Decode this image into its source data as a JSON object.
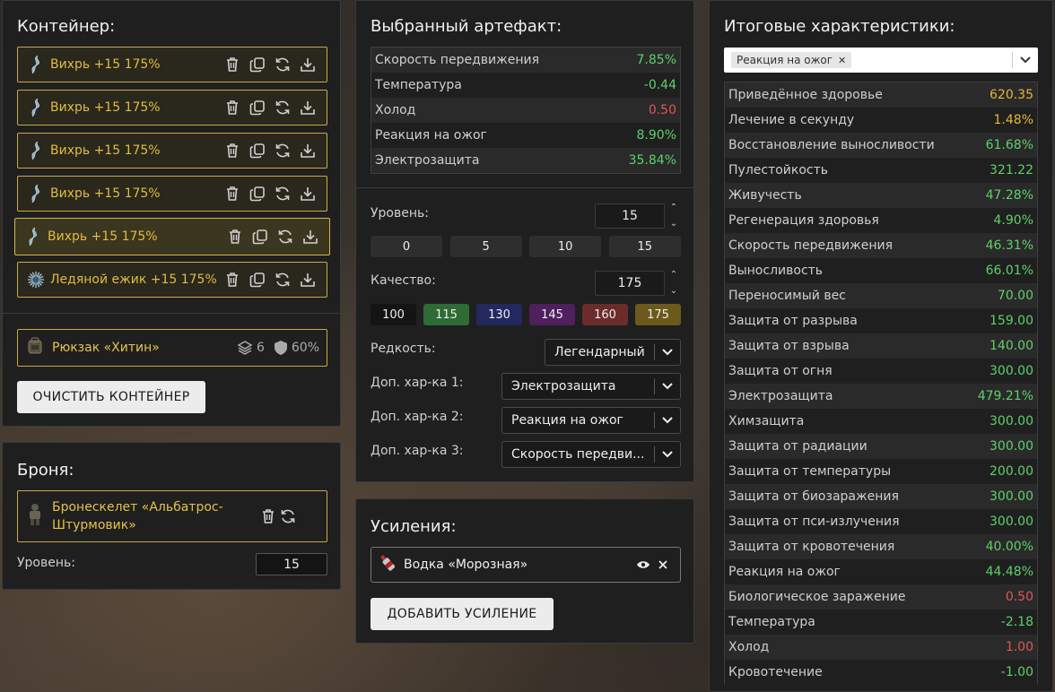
{
  "container": {
    "title": "Контейнер:",
    "artifacts": [
      {
        "label": "Вихрь +15 175%",
        "icon": "vortex-artifact-icon"
      },
      {
        "label": "Вихрь +15 175%",
        "icon": "vortex-artifact-icon"
      },
      {
        "label": "Вихрь +15 175%",
        "icon": "vortex-artifact-icon"
      },
      {
        "label": "Вихрь +15 175%",
        "icon": "vortex-artifact-icon"
      },
      {
        "label": "Вихрь +15 175%",
        "icon": "vortex-artifact-icon"
      },
      {
        "label": "Ледяной ежик +15 175%",
        "icon": "ice-hedgehog-artifact-icon"
      }
    ],
    "backpack": {
      "label": "Рюкзак «Хитин»",
      "slots": "6",
      "protection": "60%"
    },
    "clear_button": "ОЧИСТИТЬ КОНТЕЙНЕР"
  },
  "armor": {
    "title": "Броня:",
    "item_label": "Бронескелет «Альбатрос-Штурмовик»",
    "level_label": "Уровень:",
    "level_value": "15"
  },
  "artifact": {
    "title": "Выбранный артефакт:",
    "stats": [
      {
        "name": "Скорость передвижения",
        "value": "7.85%",
        "tone": "pos"
      },
      {
        "name": "Температура",
        "value": "-0.44",
        "tone": "pos"
      },
      {
        "name": "Холод",
        "value": "0.50",
        "tone": "neg"
      },
      {
        "name": "Реакция на ожог",
        "value": "8.90%",
        "tone": "pos"
      },
      {
        "name": "Электрозащита",
        "value": "35.84%",
        "tone": "pos"
      }
    ],
    "level_label": "Уровень:",
    "level_value": "15",
    "level_presets": [
      "0",
      "5",
      "10",
      "15"
    ],
    "quality_label": "Качество:",
    "quality_value": "175",
    "quality_presets": [
      {
        "label": "100",
        "color": "#141414"
      },
      {
        "label": "115",
        "color": "#2e6b35"
      },
      {
        "label": "130",
        "color": "#23285e"
      },
      {
        "label": "145",
        "color": "#4f1f5e"
      },
      {
        "label": "160",
        "color": "#6b2c2c"
      },
      {
        "label": "175",
        "color": "#6b5a1c"
      }
    ],
    "rarity_label": "Редкость:",
    "rarity_value": "Легендарный",
    "extra1_label": "Доп. хар-ка 1:",
    "extra1_value": "Электрозащита",
    "extra2_label": "Доп. хар-ка 2:",
    "extra2_value": "Реакция на ожог",
    "extra3_label": "Доп. хар-ка 3:",
    "extra3_value": "Скорость передви..."
  },
  "boosts": {
    "title": "Усиления:",
    "item_label": "Водка «Морозная»",
    "add_button": "ДОБАВИТЬ УСИЛЕНИЕ"
  },
  "totals": {
    "title": "Итоговые характеристики:",
    "filter_chip": "Реакция на ожог",
    "stats": [
      {
        "name": "Приведённое здоровье",
        "value": "620.35",
        "tone": "gold"
      },
      {
        "name": "Лечение в секунду",
        "value": "1.48%",
        "tone": "gold"
      },
      {
        "name": "Восстановление выносливости",
        "value": "61.68%",
        "tone": "pos"
      },
      {
        "name": "Пулестойкость",
        "value": "321.22",
        "tone": "pos"
      },
      {
        "name": "Живучесть",
        "value": "47.28%",
        "tone": "pos"
      },
      {
        "name": "Регенерация здоровья",
        "value": "4.90%",
        "tone": "pos"
      },
      {
        "name": "Скорость передвижения",
        "value": "46.31%",
        "tone": "pos"
      },
      {
        "name": "Выносливость",
        "value": "66.01%",
        "tone": "pos"
      },
      {
        "name": "Переносимый вес",
        "value": "70.00",
        "tone": "pos"
      },
      {
        "name": "Защита от разрыва",
        "value": "159.00",
        "tone": "pos"
      },
      {
        "name": "Защита от взрыва",
        "value": "140.00",
        "tone": "pos"
      },
      {
        "name": "Защита от огня",
        "value": "300.00",
        "tone": "pos"
      },
      {
        "name": "Электрозащита",
        "value": "479.21%",
        "tone": "pos"
      },
      {
        "name": "Химзащита",
        "value": "300.00",
        "tone": "pos"
      },
      {
        "name": "Защита от радиации",
        "value": "300.00",
        "tone": "pos"
      },
      {
        "name": "Защита от температуры",
        "value": "200.00",
        "tone": "pos"
      },
      {
        "name": "Защита от биозаражения",
        "value": "300.00",
        "tone": "pos"
      },
      {
        "name": "Защита от пси-излучения",
        "value": "300.00",
        "tone": "pos"
      },
      {
        "name": "Защита от кровотечения",
        "value": "40.00%",
        "tone": "pos"
      },
      {
        "name": "Реакция на ожог",
        "value": "44.48%",
        "tone": "pos"
      },
      {
        "name": "Биологическое заражение",
        "value": "0.50",
        "tone": "neg"
      },
      {
        "name": "Температура",
        "value": "-2.18",
        "tone": "pos"
      },
      {
        "name": "Холод",
        "value": "1.00",
        "tone": "neg"
      },
      {
        "name": "Кровотечение",
        "value": "-1.00",
        "tone": "pos"
      }
    ]
  }
}
